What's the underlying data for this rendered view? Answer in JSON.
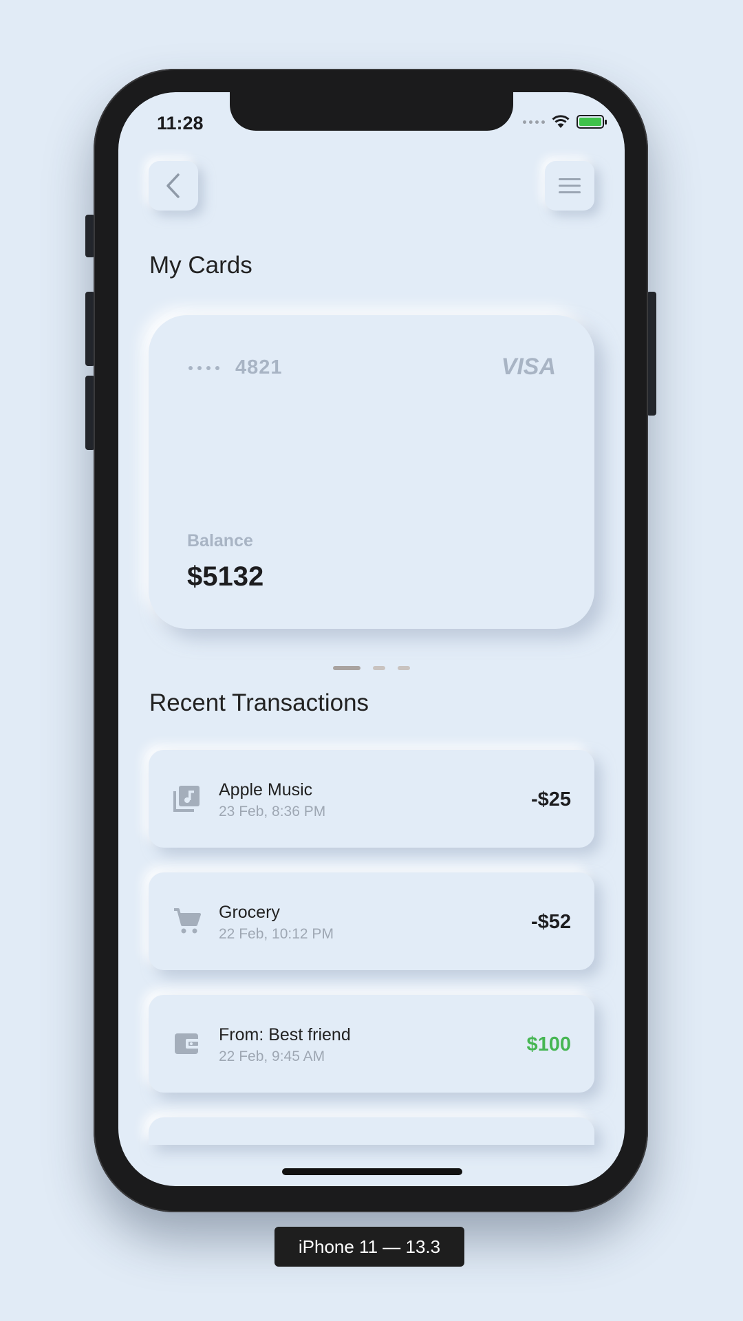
{
  "status_bar": {
    "time": "11:28"
  },
  "header": {
    "back_icon": "chevron-left-icon",
    "menu_icon": "hamburger-menu-icon"
  },
  "my_cards": {
    "title": "My Cards",
    "card": {
      "masked_dots": "••••",
      "last4": "4821",
      "brand": "VISA",
      "balance_label": "Balance",
      "balance": "$5132"
    },
    "pager": {
      "pages": 3,
      "active_index": 0
    }
  },
  "transactions": {
    "title": "Recent Transactions",
    "items": [
      {
        "name": "Apple Music",
        "date": "23 Feb, 8:36 PM",
        "amount": "-$25",
        "icon": "music-library-icon",
        "type": "debit"
      },
      {
        "name": "Grocery",
        "date": "22 Feb, 10:12 PM",
        "amount": "-$52",
        "icon": "shopping-cart-icon",
        "type": "debit"
      },
      {
        "name": "From: Best friend",
        "date": "22 Feb, 9:45 AM",
        "amount": "$100",
        "icon": "wallet-icon",
        "type": "credit"
      }
    ]
  },
  "device_label": "iPhone 11 — 13.3",
  "colors": {
    "background": "#e1ebf6",
    "credit": "#46b653",
    "muted": "#a8b4c4",
    "text": "#1d1d1f"
  }
}
